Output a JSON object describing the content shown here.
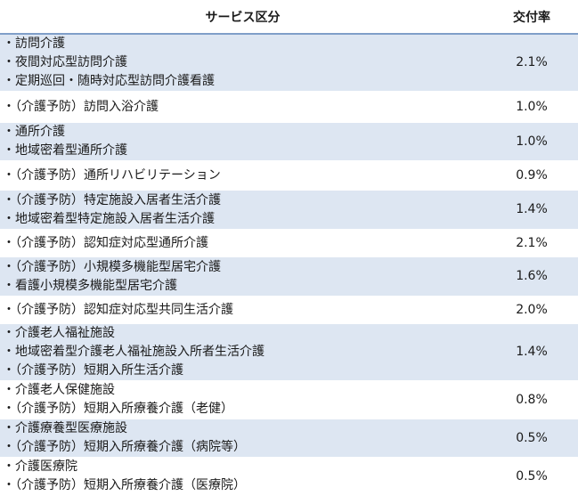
{
  "table": {
    "headers": {
      "service": "サービス区分",
      "rate": "交付率"
    },
    "rows": [
      {
        "lines": [
          "・訪問介護",
          "・夜間対応型訪問介護",
          "・定期巡回・随時対応型訪問介護看護"
        ],
        "rate": "2.1%"
      },
      {
        "lines": [
          "・（介護予防）訪問入浴介護"
        ],
        "rate": "1.0%"
      },
      {
        "lines": [
          "・通所介護",
          "・地域密着型通所介護"
        ],
        "rate": "1.0%"
      },
      {
        "lines": [
          "・（介護予防）通所リハビリテーション"
        ],
        "rate": "0.9%"
      },
      {
        "lines": [
          "・（介護予防）特定施設入居者生活介護",
          "・地域密着型特定施設入居者生活介護"
        ],
        "rate": "1.4%"
      },
      {
        "lines": [
          "・（介護予防）認知症対応型通所介護"
        ],
        "rate": "2.1%"
      },
      {
        "lines": [
          "・（介護予防）小規模多機能型居宅介護",
          "・看護小規模多機能型居宅介護"
        ],
        "rate": "1.6%"
      },
      {
        "lines": [
          "・（介護予防）認知症対応型共同生活介護"
        ],
        "rate": "2.0%"
      },
      {
        "lines": [
          "・介護老人福祉施設",
          "・地域密着型介護老人福祉施設入所者生活介護",
          "・（介護予防）短期入所生活介護"
        ],
        "rate": "1.4%"
      },
      {
        "lines": [
          "・介護老人保健施設",
          "・（介護予防）短期入所療養介護（老健）"
        ],
        "rate": "0.8%"
      },
      {
        "lines": [
          "・介護療養型医療施設",
          "・（介護予防）短期入所療養介護（病院等）"
        ],
        "rate": "0.5%"
      },
      {
        "lines": [
          "・介護医療院",
          "・（介護予防）短期入所療養介護（医療院）"
        ],
        "rate": "0.5%"
      }
    ]
  }
}
